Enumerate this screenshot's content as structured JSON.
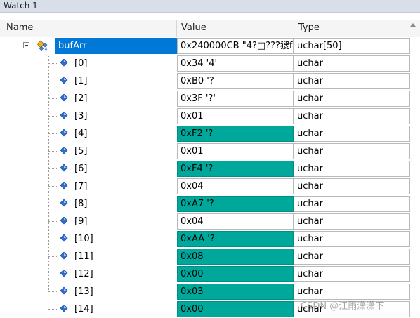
{
  "window": {
    "title": "Watch 1"
  },
  "columns": {
    "name": "Name",
    "value": "Value",
    "type": "Type"
  },
  "root": {
    "name": "bufArr",
    "value": "0x240000CB \"4?□???獀f\"",
    "type": "uchar[50]"
  },
  "rows": [
    {
      "name": "[0]",
      "value": "0x34 '4'",
      "type": "uchar",
      "changed": false
    },
    {
      "name": "[1]",
      "value": "0xB0 '?",
      "type": "uchar",
      "changed": false
    },
    {
      "name": "[2]",
      "value": "0x3F '?'",
      "type": "uchar",
      "changed": false
    },
    {
      "name": "[3]",
      "value": "0x01",
      "type": "uchar",
      "changed": false
    },
    {
      "name": "[4]",
      "value": "0xF2 '?",
      "type": "uchar",
      "changed": true
    },
    {
      "name": "[5]",
      "value": "0x01",
      "type": "uchar",
      "changed": false
    },
    {
      "name": "[6]",
      "value": "0xF4 '?",
      "type": "uchar",
      "changed": true
    },
    {
      "name": "[7]",
      "value": "0x04",
      "type": "uchar",
      "changed": false
    },
    {
      "name": "[8]",
      "value": "0xA7 '?",
      "type": "uchar",
      "changed": true
    },
    {
      "name": "[9]",
      "value": "0x04",
      "type": "uchar",
      "changed": false
    },
    {
      "name": "[10]",
      "value": "0xAA '?",
      "type": "uchar",
      "changed": true
    },
    {
      "name": "[11]",
      "value": "0x08",
      "type": "uchar",
      "changed": true
    },
    {
      "name": "[12]",
      "value": "0x00",
      "type": "uchar",
      "changed": true
    },
    {
      "name": "[13]",
      "value": "0x03",
      "type": "uchar",
      "changed": true
    },
    {
      "name": "[14]",
      "value": "0x00",
      "type": "uchar",
      "changed": true
    }
  ],
  "watermark": "CSDN @江雨潇潇下",
  "colors": {
    "changed_bg": "#00a89c",
    "selection": "#0078d7",
    "header_bg": "#f5f5f5"
  },
  "icons": {
    "struct": "struct-watch-icon",
    "element": "diamond-element-icon",
    "collapse": "collapse-minus-icon"
  }
}
